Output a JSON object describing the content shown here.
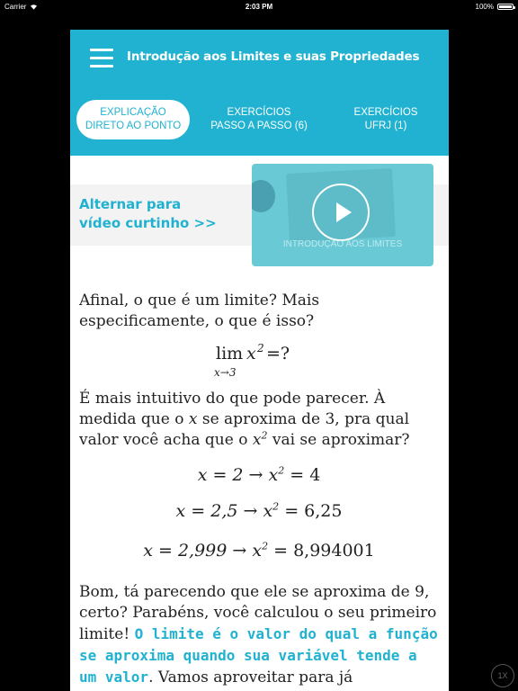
{
  "status_bar": {
    "carrier": "Carrier",
    "time": "2:03 PM",
    "battery": "100%",
    "battery_level": 1.0
  },
  "header": {
    "title": "Introdução aos Limites e suas Propriedades",
    "tabs": [
      {
        "line1": "EXPLICAÇÃO",
        "line2": "DIRETO AO PONTO",
        "active": true
      },
      {
        "line1": "EXERCÍCIOS",
        "line2": "PASSO A PASSO (6)",
        "active": false
      },
      {
        "line1": "EXERCÍCIOS",
        "line2": "UFRJ (1)",
        "active": false
      }
    ]
  },
  "promo": {
    "line1": "Alternar para",
    "line2": "vídeo curtinho >>",
    "video_caption": "INTRODUÇÃO AOS LIMITES"
  },
  "content": {
    "p1": "Afinal, o que é um limite? Mais especificamente, o que é isso?",
    "f1_lim": "lim",
    "f1_sub": "x→3",
    "f1_body": "x",
    "f1_sup": "2",
    "f1_tail": " =?",
    "p2_a": "É mais intuitivo do que pode parecer. À medida que o ",
    "p2_x": "x",
    "p2_b": " se aproxima de ",
    "p2_3": "3",
    "p2_c": ", pra qual valor você acha que o ",
    "p2_x2": "x",
    "p2_sup": "2",
    "p2_d": "  vai se aproximar?",
    "eq1_l": "x = 2 → x",
    "eq1_r": " = 4",
    "eq2_l": "x = 2,5 → x",
    "eq2_r": " = 6,25",
    "eq3_l": "x = 2,999 → x",
    "eq3_r": " = 8,994001",
    "eq_sup": "2",
    "p3_a": "Bom, tá parecendo que ele se aproxima de ",
    "p3_9": "9",
    "p3_b": ", certo? Parabéns, você calculou o seu primeiro limite! ",
    "p3_highlight": "O limite é o valor do qual a função se aproxima quando sua variável tende a um valor",
    "p3_c": ". Vamos aproveitar para já"
  },
  "speed_button": "1X"
}
